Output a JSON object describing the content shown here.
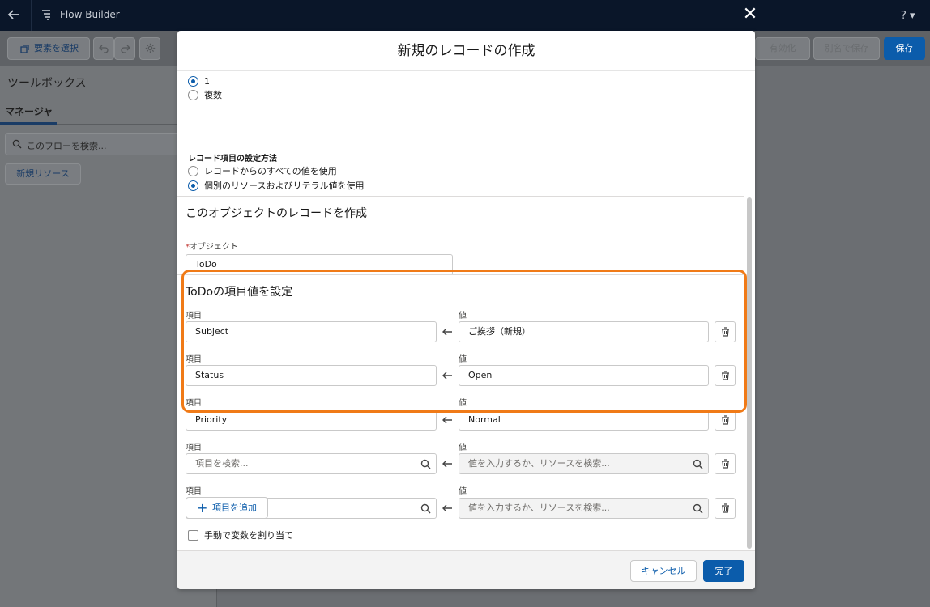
{
  "app": {
    "title": "Flow Builder",
    "help_label": "? ▾"
  },
  "toolbar": {
    "select_elements": "要素を選択",
    "activate": "有効化",
    "save_as": "別名で保存",
    "save": "保存"
  },
  "toolbox": {
    "title": "ツールボックス",
    "tab_manager": "マネージャ",
    "search_placeholder": "このフローを検索...",
    "new_resource": "新規リソース"
  },
  "modal": {
    "title": "新規のレコードの作成",
    "count_options": [
      {
        "label": "1",
        "checked": true
      },
      {
        "label": "複数",
        "checked": false
      }
    ],
    "set_fields_label": "レコード項目の設定方法",
    "set_fields_options": [
      {
        "label": "レコードからのすべての値を使用",
        "checked": false
      },
      {
        "label": "個別のリソースおよびリテラル値を使用",
        "checked": true
      }
    ],
    "create_section_title": "このオブジェクトのレコードを作成",
    "object_label": "オブジェクト",
    "object_value": "ToDo",
    "field_values_title": "ToDoの項目値を設定",
    "field_col_label": "項目",
    "value_col_label": "値",
    "assignments": [
      {
        "field": "Subject",
        "value": "ご挨拶（新規）"
      },
      {
        "field": "Status",
        "value": "Open"
      },
      {
        "field": "Priority",
        "value": "Normal"
      }
    ],
    "field_placeholder": "項目を検索...",
    "value_placeholder": "値を入力するか、リソースを検索...",
    "add_field": "項目を追加",
    "manual_assign": "手動で変数を割り当て",
    "cancel": "キャンセル",
    "done": "完了"
  },
  "colors": {
    "brand": "#0b5cab",
    "highlight": "#f07a17",
    "header_bg": "#0a1629"
  }
}
